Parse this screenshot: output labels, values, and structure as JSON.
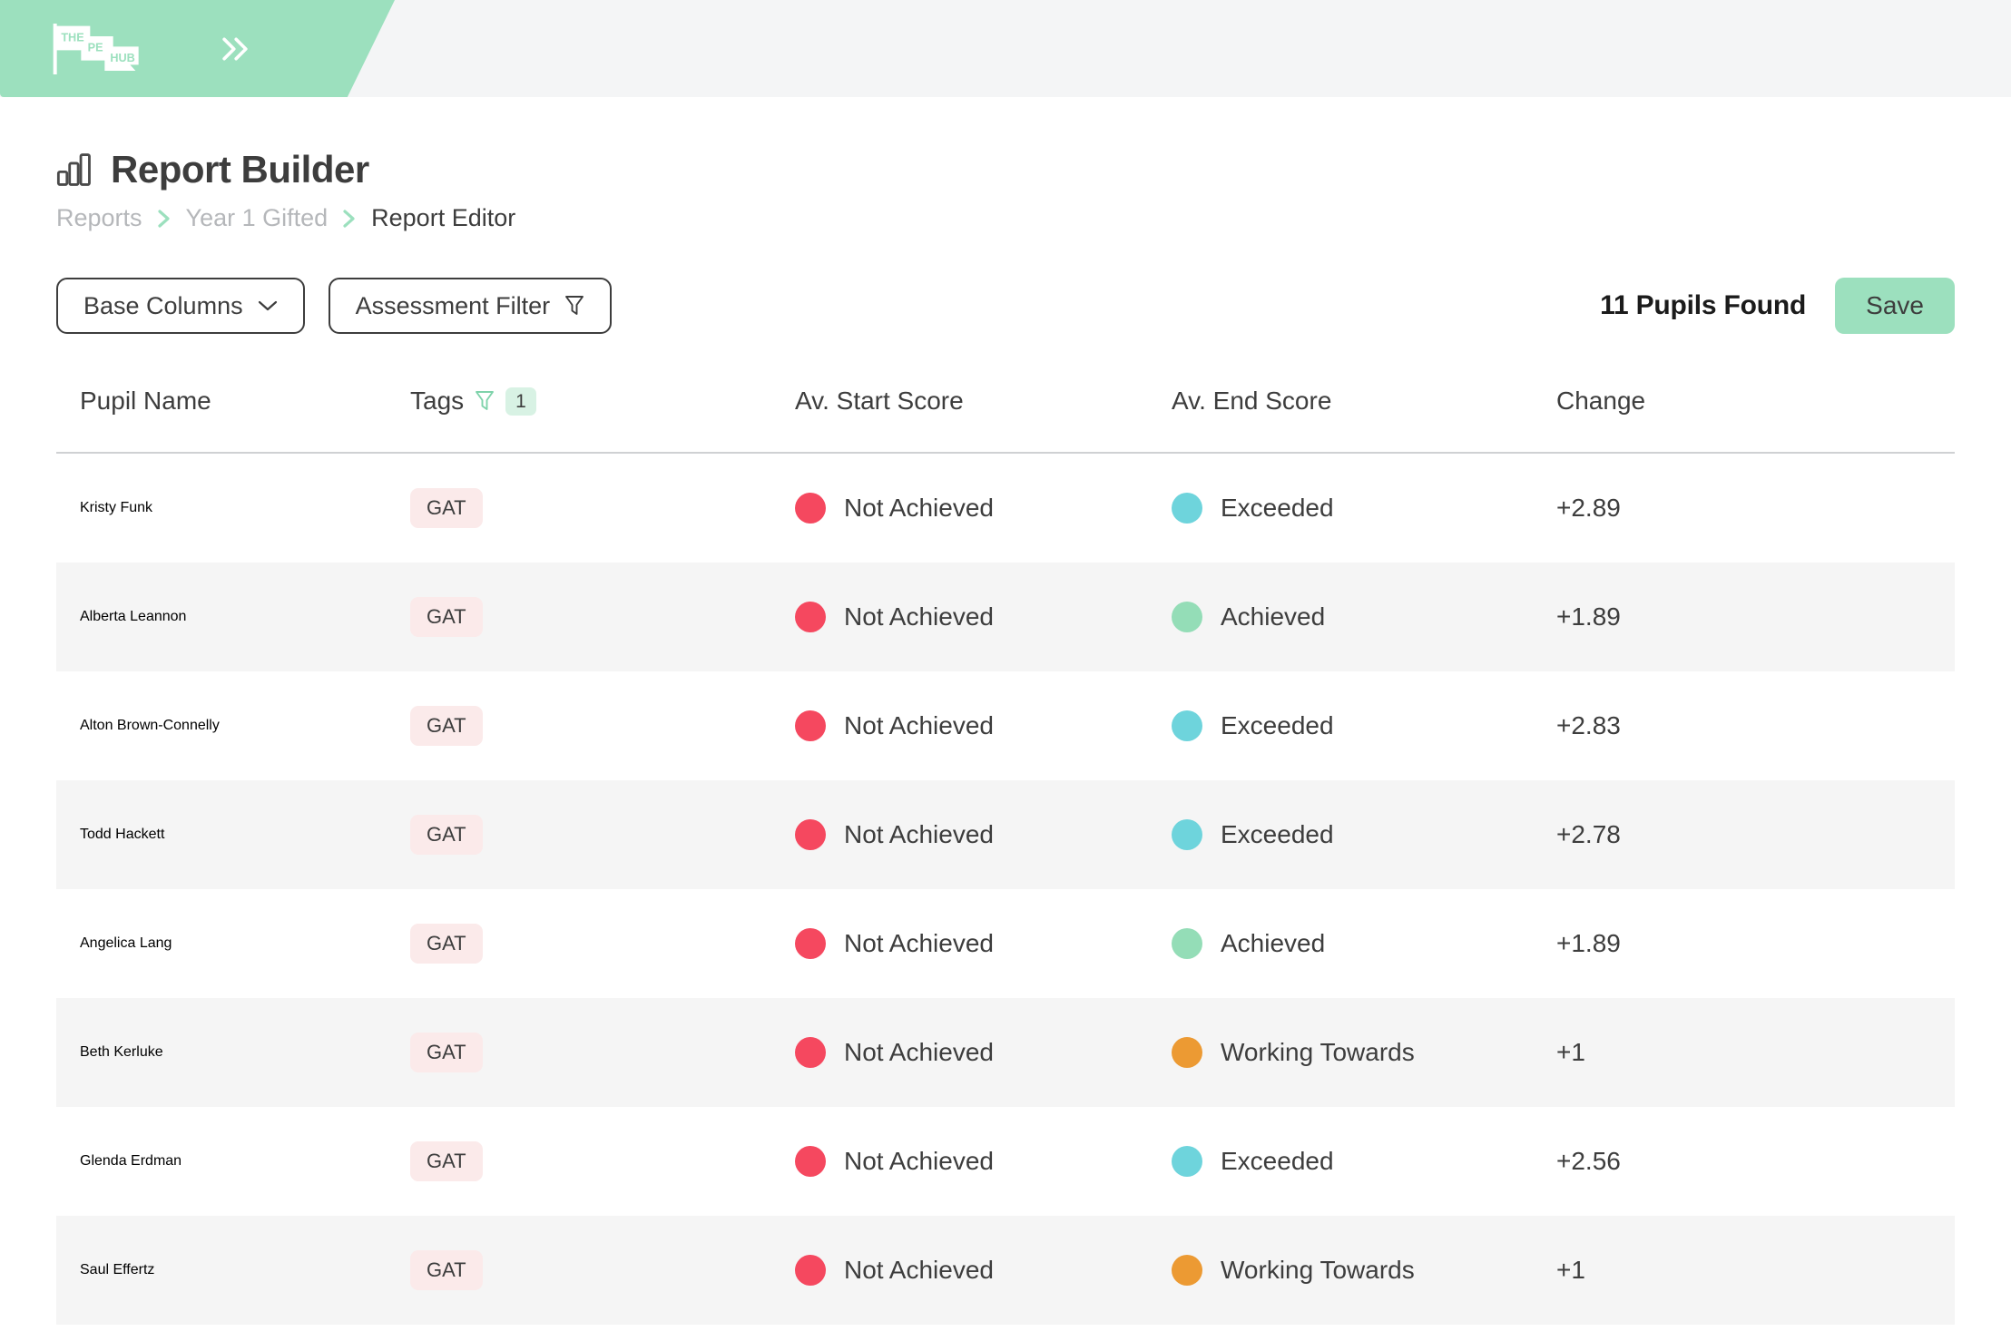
{
  "topbar": {
    "logo_text": "THE PE HUB",
    "logo_icon": "pe-hub-flag-logo",
    "expand_icon": "double-chevron-right-icon"
  },
  "header": {
    "title": "Report Builder",
    "title_icon": "bar-chart-icon",
    "breadcrumb": [
      {
        "label": "Reports",
        "current": false
      },
      {
        "label": "Year 1 Gifted",
        "current": false
      },
      {
        "label": "Report Editor",
        "current": true
      }
    ],
    "breadcrumb_separator_icon": "chevron-right-icon"
  },
  "controls": {
    "base_columns_label": "Base Columns",
    "base_columns_icon": "chevron-down-icon",
    "assessment_filter_label": "Assessment Filter",
    "assessment_filter_icon": "funnel-filter-icon",
    "pupils_found": "11 Pupils Found",
    "save_label": "Save"
  },
  "table": {
    "columns": [
      "Pupil Name",
      "Tags",
      "Av. Start Score",
      "Av. End Score",
      "Change"
    ],
    "tags_filter_icon": "funnel-filter-icon",
    "tags_filter_count": "1",
    "rows": [
      {
        "name": "Kristy Funk",
        "tag": "GAT",
        "start_score": "Not Achieved",
        "start_color": "#f5485f",
        "end_score": "Exceeded",
        "end_color": "#6ed4dc",
        "change": "+2.89"
      },
      {
        "name": "Alberta Leannon",
        "tag": "GAT",
        "start_score": "Not Achieved",
        "start_color": "#f5485f",
        "end_score": "Achieved",
        "end_color": "#94ddb7",
        "change": "+1.89"
      },
      {
        "name": "Alton Brown-Connelly",
        "tag": "GAT",
        "start_score": "Not Achieved",
        "start_color": "#f5485f",
        "end_score": "Exceeded",
        "end_color": "#6ed4dc",
        "change": "+2.83"
      },
      {
        "name": "Todd Hackett",
        "tag": "GAT",
        "start_score": "Not Achieved",
        "start_color": "#f5485f",
        "end_score": "Exceeded",
        "end_color": "#6ed4dc",
        "change": "+2.78"
      },
      {
        "name": "Angelica Lang",
        "tag": "GAT",
        "start_score": "Not Achieved",
        "start_color": "#f5485f",
        "end_score": "Achieved",
        "end_color": "#94ddb7",
        "change": "+1.89"
      },
      {
        "name": "Beth Kerluke",
        "tag": "GAT",
        "start_score": "Not Achieved",
        "start_color": "#f5485f",
        "end_score": "Working Towards",
        "end_color": "#ec9a33",
        "change": "+1"
      },
      {
        "name": "Glenda Erdman",
        "tag": "GAT",
        "start_score": "Not Achieved",
        "start_color": "#f5485f",
        "end_score": "Exceeded",
        "end_color": "#6ed4dc",
        "change": "+2.56"
      },
      {
        "name": "Saul Effertz",
        "tag": "GAT",
        "start_score": "Not Achieved",
        "start_color": "#f5485f",
        "end_score": "Working Towards",
        "end_color": "#ec9a33",
        "change": "+1"
      }
    ]
  },
  "colors": {
    "brand_green": "#9ce0be",
    "topbar_bg": "#f4f5f6",
    "text_dark": "#3d3d3d",
    "muted": "#b5b7ba",
    "row_alt": "#f5f5f5",
    "tag_bg": "#fbeaea",
    "badge_bg": "#d8f2e4",
    "not_achieved": "#f5485f",
    "working_towards": "#ec9a33",
    "achieved": "#94ddb7",
    "exceeded": "#6ed4dc"
  }
}
